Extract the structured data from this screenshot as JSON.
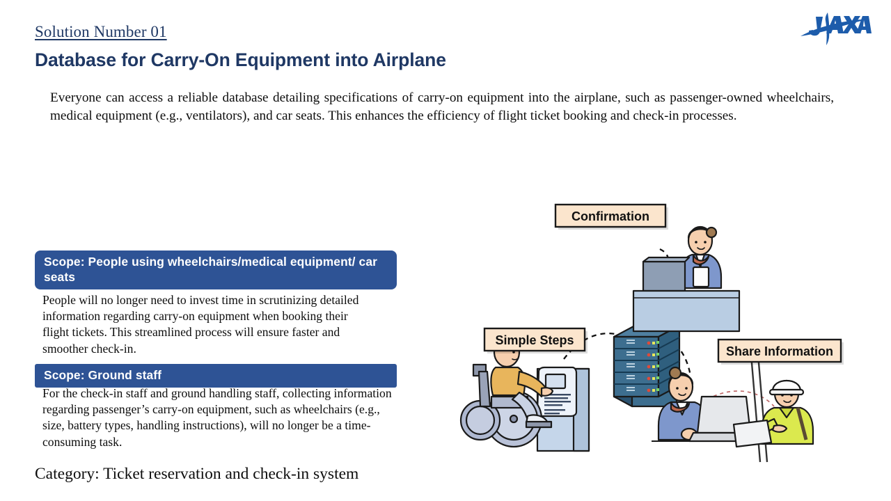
{
  "header": {
    "solution_number": "Solution Number 01",
    "title": "Database for Carry-On Equipment into Airplane",
    "logo_name": "JAXA"
  },
  "lead_paragraph": "Everyone can access a reliable database detailing specifications of carry-on equipment into the airplane, such as passenger-owned wheelchairs, medical equipment (e.g., ventilators), and car seats. This enhances the efficiency of flight ticket booking and check-in processes.",
  "scopes": [
    {
      "banner": "Scope: People using wheelchairs/medical equipment/ car seats",
      "body": "People will no longer need to invest time in scrutinizing detailed information regarding carry-on equipment when booking their flight tickets. This streamlined process will ensure faster and smoother check-in."
    },
    {
      "banner": "Scope: Ground staff",
      "body": "For the check-in staff and ground handling staff, collecting information regarding passenger’s carry-on equipment, such as wheelchairs (e.g., size, battery types, handling instructions), will no longer be a time-consuming task."
    }
  ],
  "category": "Category: Ticket reservation and check-in system",
  "illustration": {
    "callouts": [
      {
        "id": "confirmation",
        "label": "Confirmation"
      },
      {
        "id": "simple-steps",
        "label": "Simple Steps"
      },
      {
        "id": "share-information",
        "label": "Share Information"
      }
    ],
    "elements": [
      "server-rack",
      "wheelchair-user-at-kiosk",
      "check-in-counter-staff",
      "laptop-user",
      "ground-handler-with-tablet",
      "signpost"
    ]
  },
  "colors": {
    "brand_blue": "#1f3864",
    "banner_blue": "#2e5395",
    "callout_fill": "#fbe5cd",
    "server_blue": "#3d6e8f",
    "jaxa_blue": "#1d5cab",
    "kiosk_blue": "#c5d6ea",
    "hivis_yellow": "#dbe94e"
  }
}
